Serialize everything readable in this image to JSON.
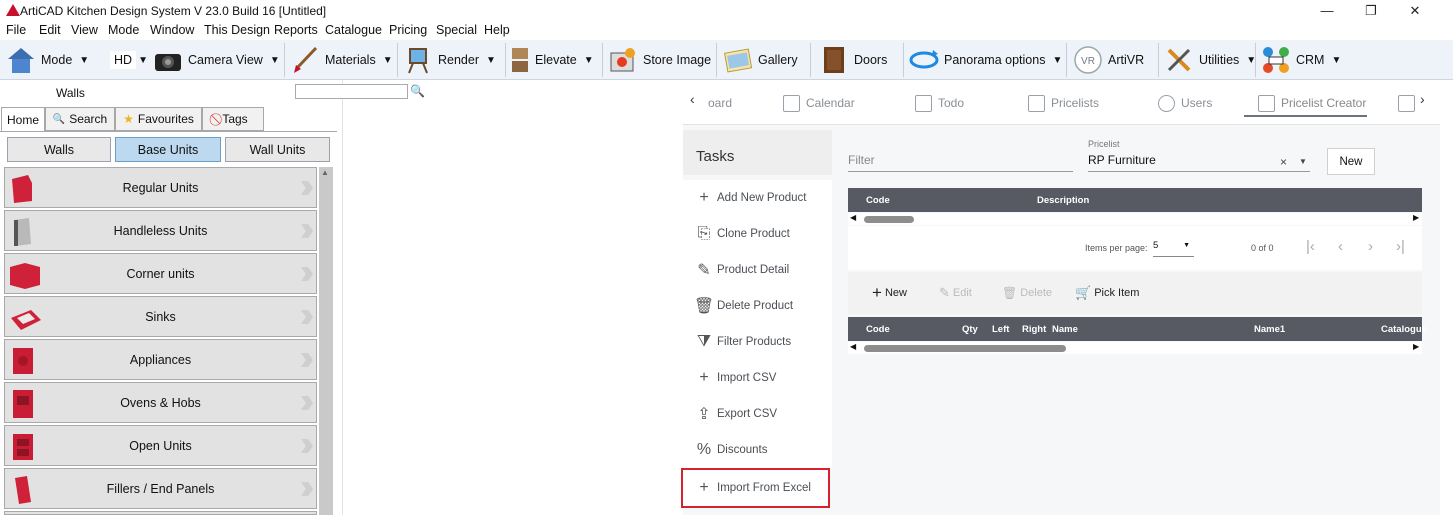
{
  "window": {
    "title": "ArtiCAD Kitchen Design System  V 23.0 Build 16  [Untitled]",
    "minimize": "—",
    "maximize": "❐",
    "close": "✕"
  },
  "menu": [
    "File",
    "Edit",
    "View",
    "Mode",
    "Window",
    "This Design",
    "Reports",
    "Catalogue",
    "Pricing",
    "Special",
    "Help"
  ],
  "toolbar": {
    "mode": "Mode",
    "hd": "HD",
    "camera_view": "Camera View",
    "materials": "Materials",
    "render": "Render",
    "elevate": "Elevate",
    "store_image": "Store Image",
    "gallery": "Gallery",
    "doors": "Doors",
    "panorama": "Panorama options",
    "artivr": "ArtiVR",
    "utilities": "Utilities",
    "crm": "CRM",
    "dropdown_glyph": "▼"
  },
  "left": {
    "heading": "Walls",
    "search_value": "",
    "tabs": [
      "Home",
      "Search",
      "Favourites",
      "Tags"
    ],
    "categories": [
      "Walls",
      "Base Units",
      "Wall Units"
    ],
    "selected_category": "Base Units",
    "units": [
      "Regular Units",
      "Handleless Units",
      "Corner units",
      "Sinks",
      "Appliances",
      "Ovens & Hobs",
      "Open Units",
      "Fillers / End Panels"
    ]
  },
  "right": {
    "tabs": [
      "oard",
      "Calendar",
      "Todo",
      "Pricelists",
      "Users",
      "Pricelist Creator"
    ],
    "active_tab": "Pricelist Creator",
    "tasks_title": "Tasks",
    "tasks": [
      "Add New Product",
      "Clone Product",
      "Product Detail",
      "Delete Product",
      "Filter Products",
      "Import CSV",
      "Export CSV",
      "Discounts",
      "Import From Excel"
    ],
    "highlighted_task": "Import From Excel",
    "filter_placeholder": "Filter",
    "pricelist_label": "Pricelist",
    "pricelist_value": "RP Furniture",
    "new_button": "New",
    "grid1_headers": [
      "Code",
      "Description"
    ],
    "items_per_page_label": "Items per page:",
    "items_per_page": "5",
    "range": "0 of 0",
    "actions": [
      "New",
      "Edit",
      "Delete",
      "Pick Item"
    ],
    "grid2_headers": [
      "Code",
      "Qty",
      "Left",
      "Right",
      "Name",
      "Name1",
      "Catalogue"
    ]
  }
}
